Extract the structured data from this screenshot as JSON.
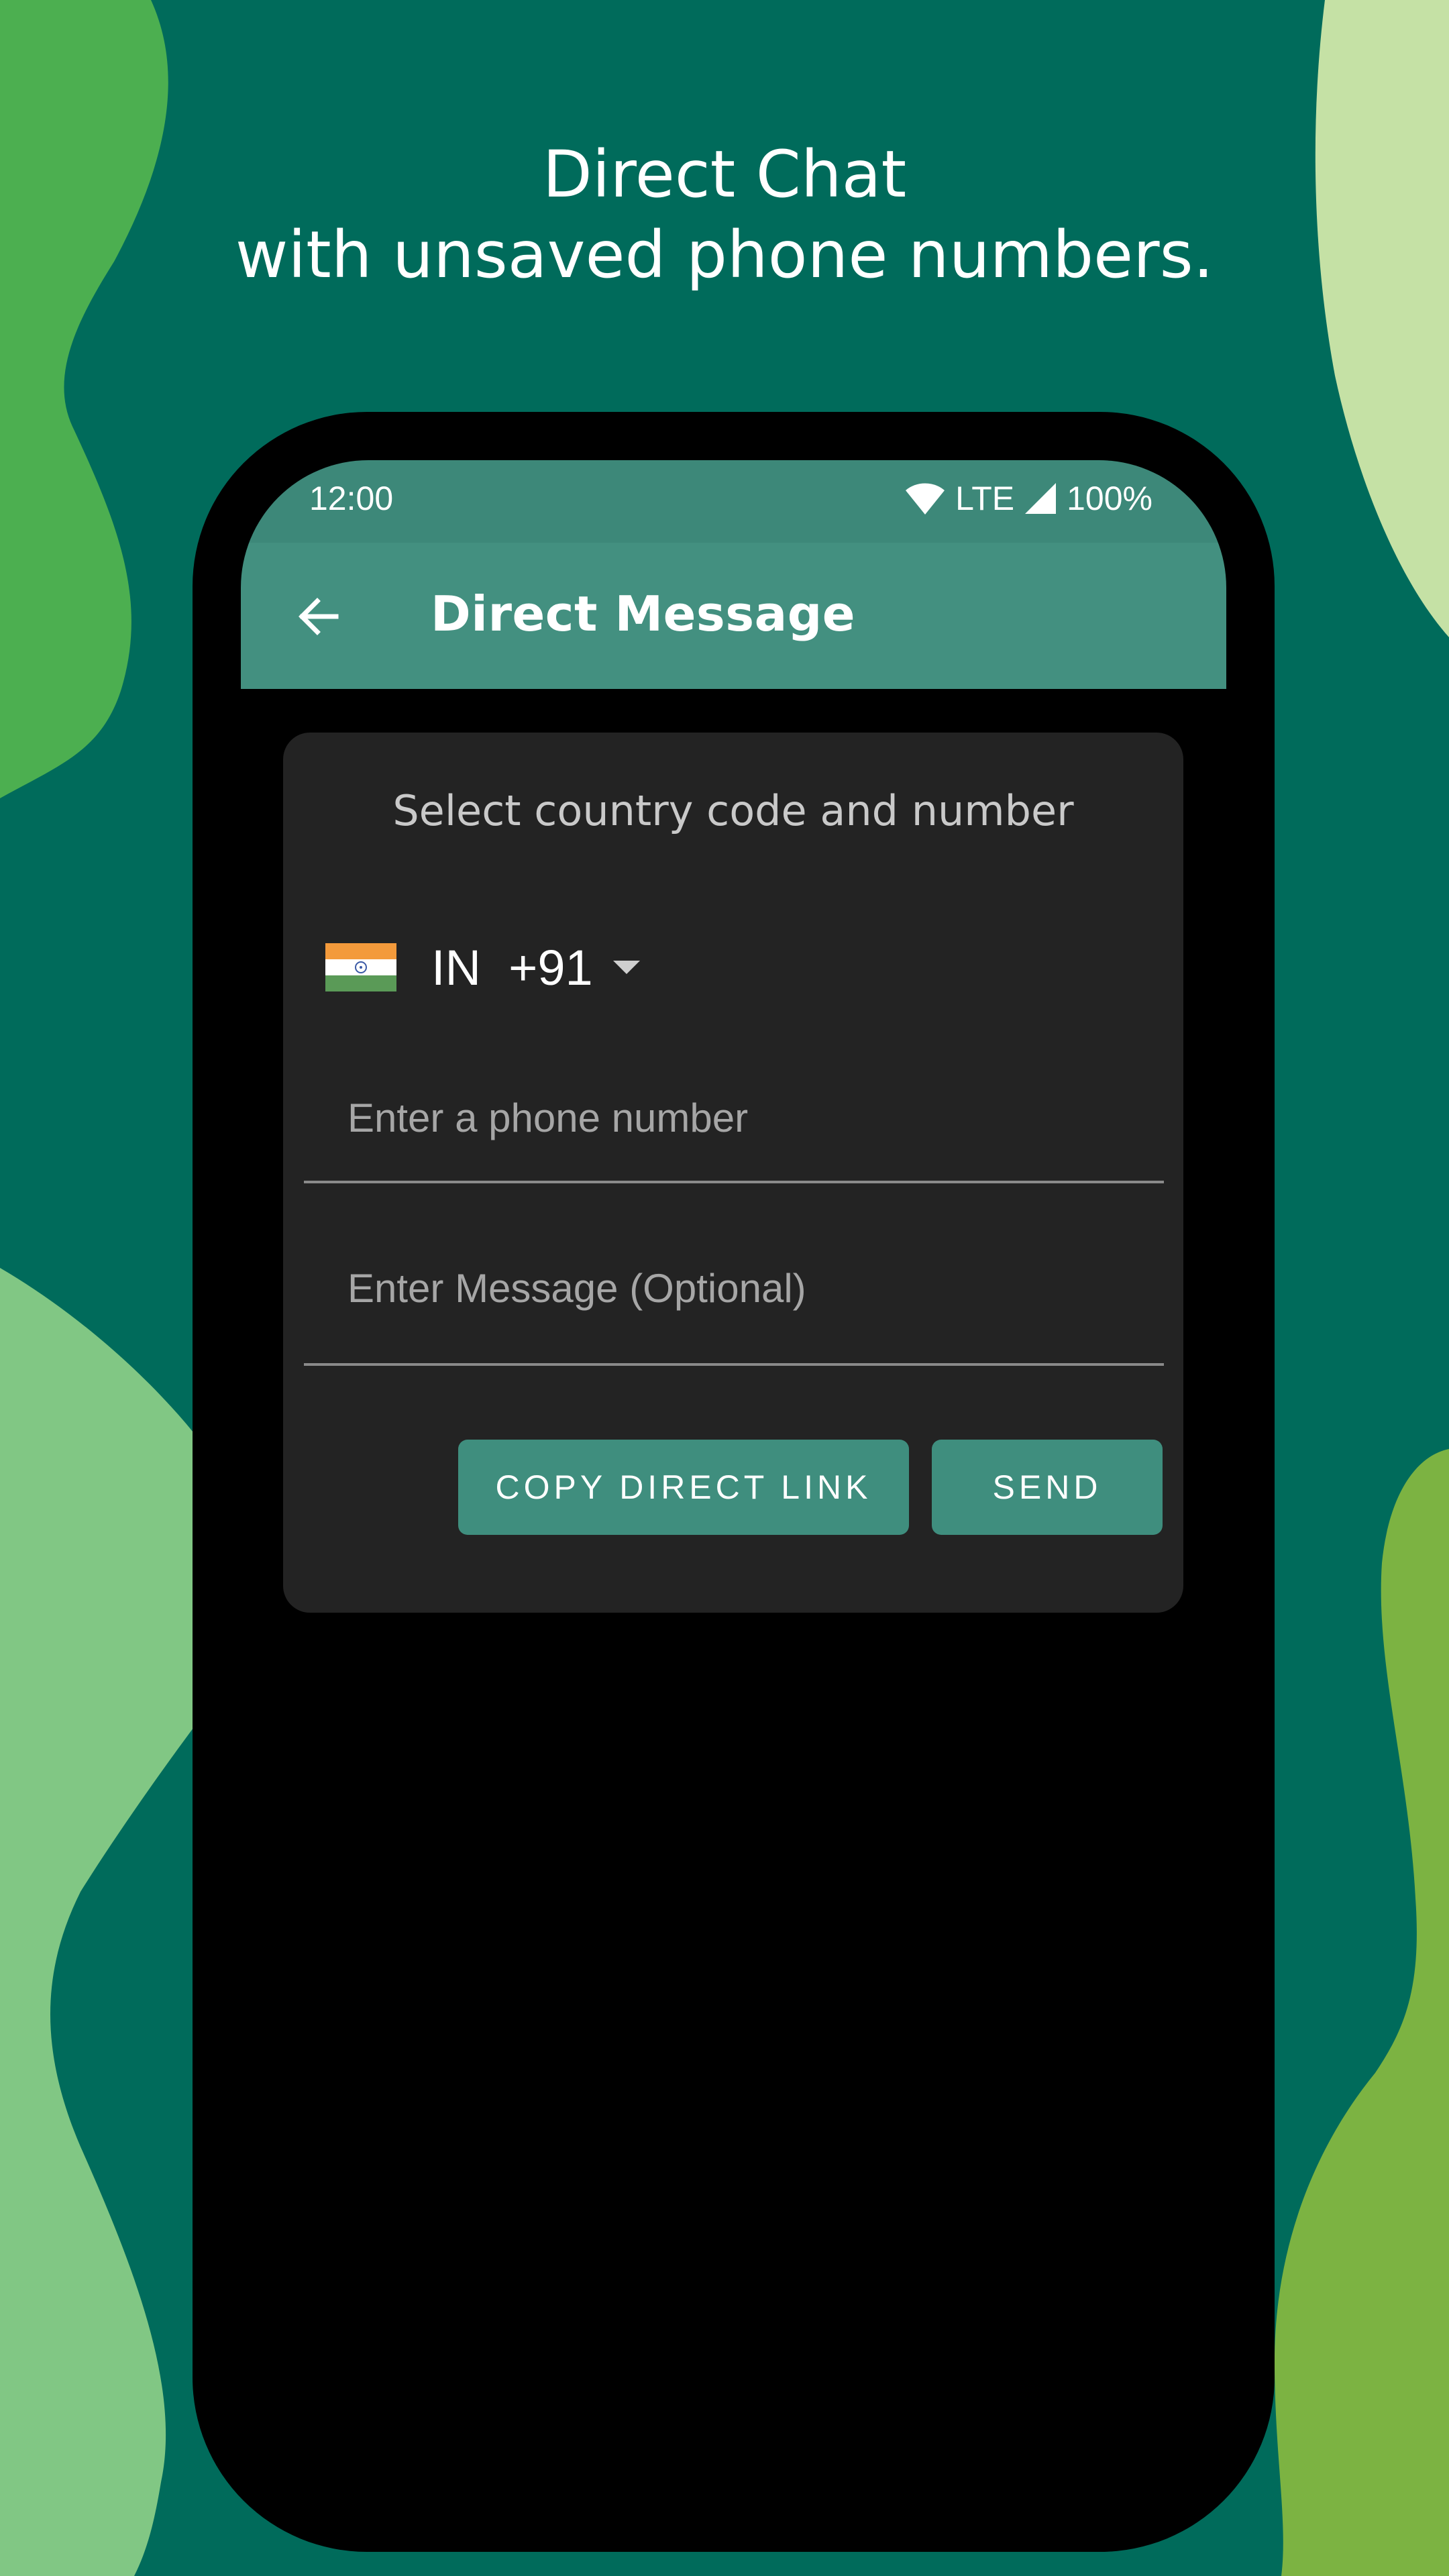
{
  "headline": {
    "line1": "Direct Chat",
    "line2": "with unsaved phone numbers."
  },
  "status_bar": {
    "time": "12:00",
    "network": "LTE",
    "battery": "100%"
  },
  "app_bar": {
    "title": "Direct Message"
  },
  "form": {
    "title": "Select country code and number",
    "country": {
      "iso": "IN",
      "dial_code": "+91",
      "display": "IN  +91"
    },
    "phone_placeholder": "Enter a phone number",
    "message_placeholder": "Enter Message (Optional)",
    "copy_button": "COPY DIRECT LINK",
    "send_button": "SEND"
  },
  "colors": {
    "background": "#006b5b",
    "accent": "#439080",
    "card": "#232323"
  }
}
